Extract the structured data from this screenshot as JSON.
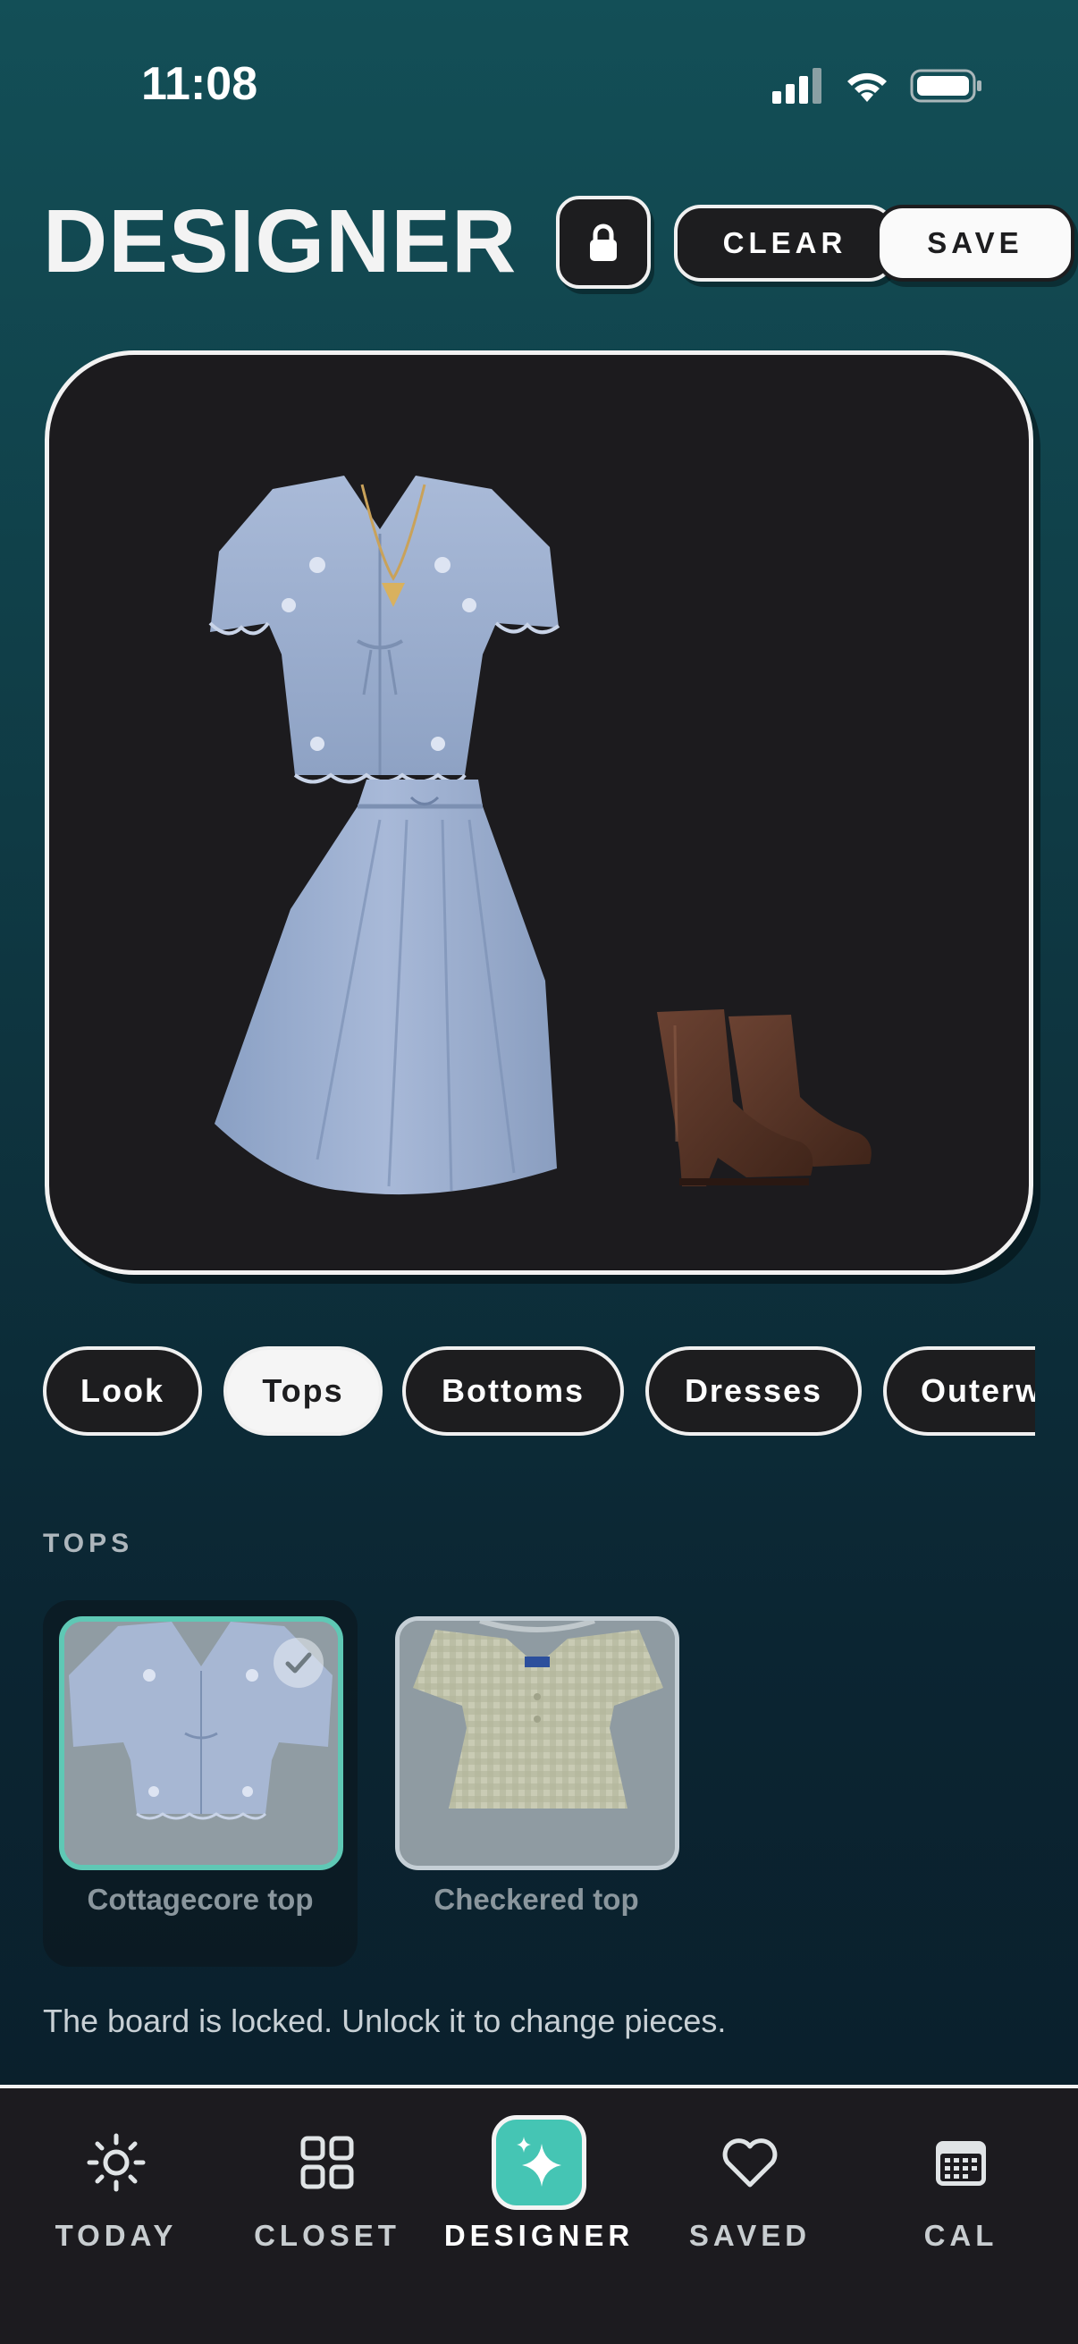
{
  "status_bar": {
    "time": "11:08"
  },
  "header": {
    "title": "DESIGNER",
    "lock_icon": "lock-icon",
    "clear_label": "CLEAR",
    "save_label": "SAVE"
  },
  "board": {
    "items": [
      "blouse",
      "necklace",
      "maxi-skirt",
      "ankle-boots"
    ]
  },
  "tabs": [
    {
      "label": "Look",
      "active": false
    },
    {
      "label": "Tops",
      "active": true
    },
    {
      "label": "Bottoms",
      "active": false
    },
    {
      "label": "Dresses",
      "active": false
    },
    {
      "label": "Outerwear",
      "active": false
    }
  ],
  "section": {
    "label": "TOPS",
    "items": [
      {
        "label": "Cottagecore top",
        "selected": true
      },
      {
        "label": "Checkered top",
        "selected": false
      }
    ]
  },
  "lock_note": "The board is locked. Unlock it to change pieces.",
  "nav": {
    "items": [
      {
        "label": "TODAY",
        "icon": "sun-icon",
        "active": false
      },
      {
        "label": "CLOSET",
        "icon": "grid-icon",
        "active": false
      },
      {
        "label": "DESIGNER",
        "icon": "sparkle-icon",
        "active": true
      },
      {
        "label": "SAVED",
        "icon": "heart-icon",
        "active": false
      },
      {
        "label": "CAL",
        "icon": "calendar-icon",
        "active": false
      }
    ]
  },
  "colors": {
    "accent": "#45c5b4",
    "selected_border": "#5fc8b5",
    "panel": "#1c1b1e"
  }
}
